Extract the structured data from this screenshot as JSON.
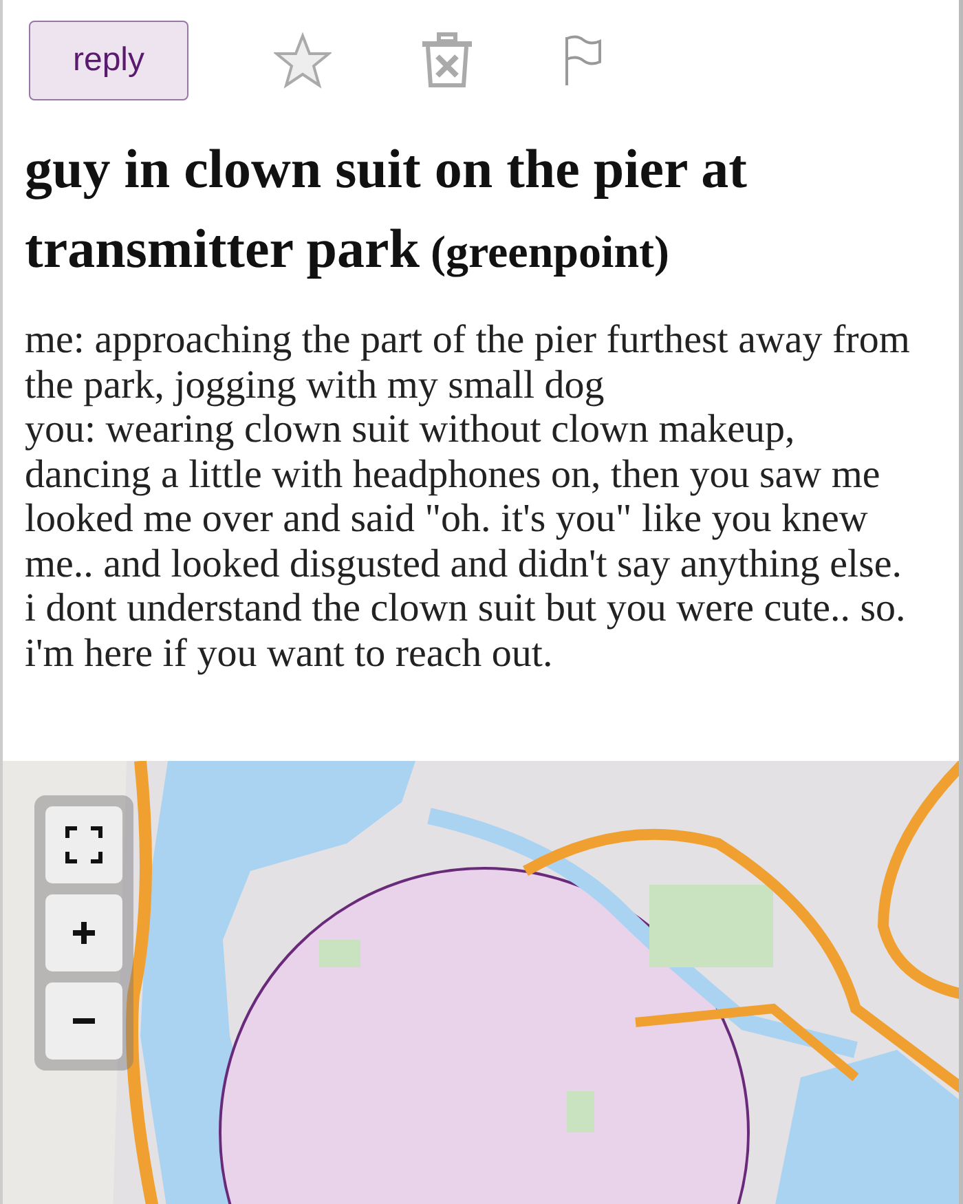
{
  "toolbar": {
    "reply_label": "reply",
    "actions": [
      {
        "kind": "favorite"
      },
      {
        "kind": "hide"
      },
      {
        "kind": "flag"
      }
    ]
  },
  "post": {
    "title_lines": [
      "guy in clown suit on the pier at",
      "transmitter park"
    ],
    "location": "(greenpoint)",
    "body_lines": [
      "me: approaching the part of the pier furthest away from",
      "the park, jogging with my small dog",
      "you: wearing clown suit without clown makeup,",
      "dancing a little with headphones on, then you saw me",
      "looked me over and said \"oh. it's you\" like you knew",
      "me.. and looked disgusted and didn't say anything else.",
      "i dont understand the clown suit but you were cute.. so.",
      "i'm here if you want to reach out."
    ]
  },
  "map": {
    "kind": "picture",
    "controls": [
      {
        "kind": "fullscreen"
      },
      {
        "kind": "zoom_in"
      },
      {
        "kind": "zoom_out"
      }
    ]
  }
}
